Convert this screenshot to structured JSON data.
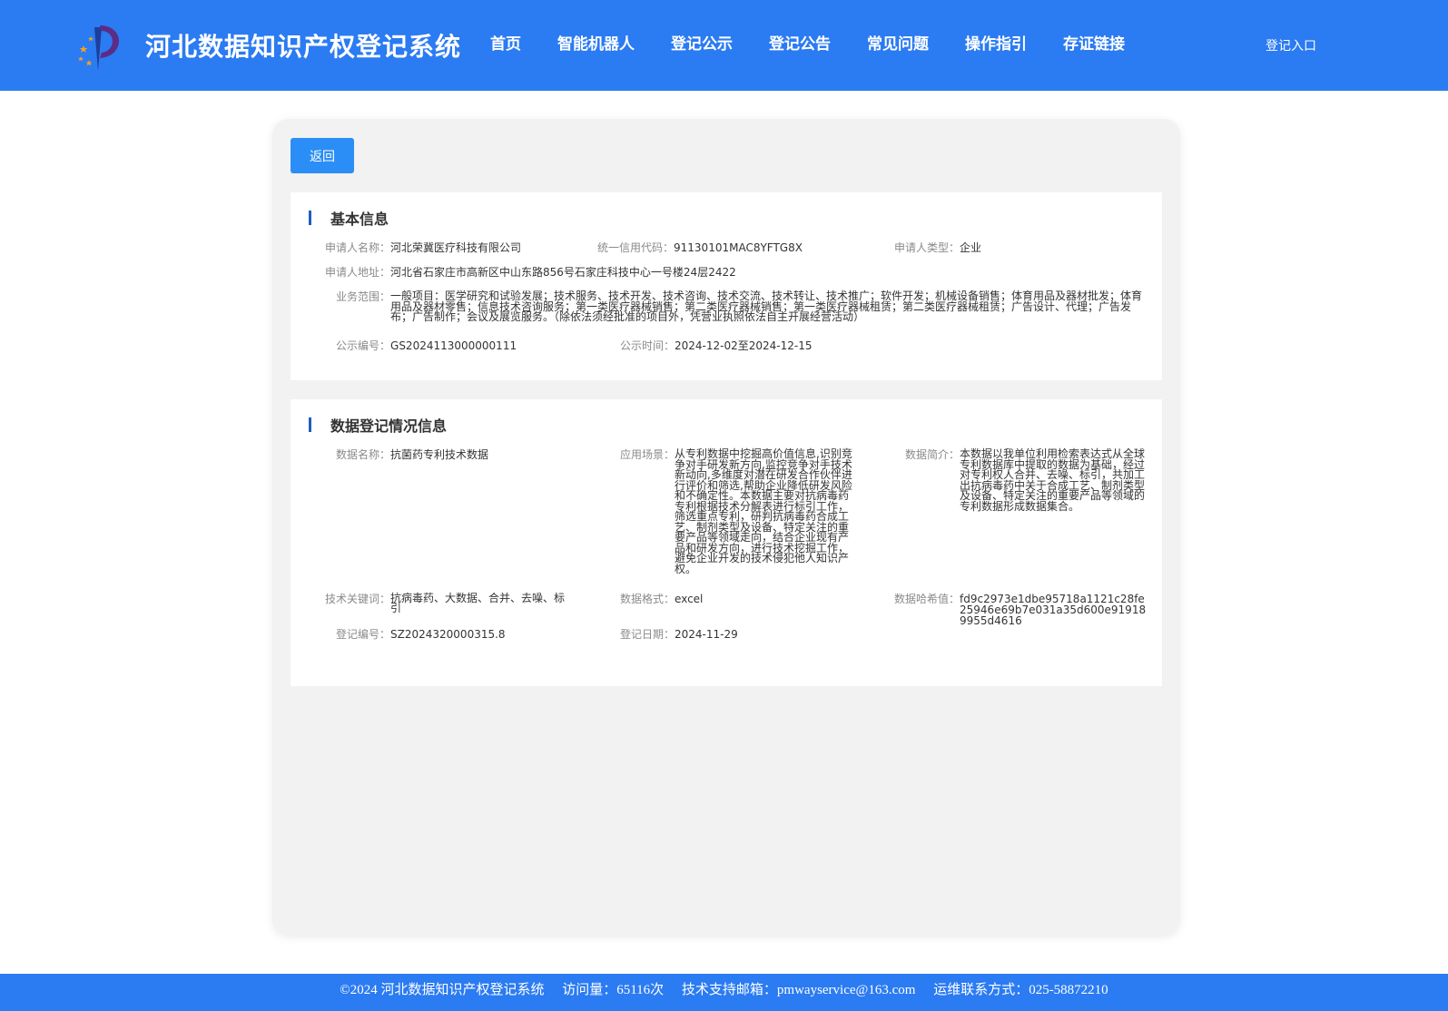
{
  "header": {
    "title": "河北数据知识产权登记系统",
    "login": "登记入口",
    "nav": [
      "首页",
      "智能机器人",
      "登记公示",
      "登记公告",
      "常见问题",
      "操作指引",
      "存证链接"
    ]
  },
  "back_label": "返回",
  "basic": {
    "heading": "基本信息",
    "applicant_name_label": "申请人名称：",
    "applicant_name": "河北荣冀医疗科技有限公司",
    "credit_code_label": "统一信用代码：",
    "credit_code": "91130101MAC8YFTG8X",
    "applicant_type_label": "申请人类型：",
    "applicant_type": "企业",
    "address_label": "申请人地址：",
    "address": "河北省石家庄市高新区中山东路856号石家庄科技中心一号楼24层2422",
    "scope_label": "业务范围：",
    "scope": "一般项目：医学研究和试验发展；技术服务、技术开发、技术咨询、技术交流、技术转让、技术推广；软件开发；机械设备销售；体育用品及器材批发；体育用品及器材零售；信息技术咨询服务；第一类医疗器械销售；第二类医疗器械销售；第一类医疗器械租赁；第二类医疗器械租赁；广告设计、代理；广告发布；广告制作；会议及展览服务。（除依法须经批准的项目外，凭营业执照依法自主开展经营活动）",
    "notice_no_label": "公示编号：",
    "notice_no": "GS2024113000000111",
    "notice_time_label": "公示时间：",
    "notice_time": "2024-12-02至2024-12-15"
  },
  "registration": {
    "heading": "数据登记情况信息",
    "data_name_label": "数据名称：",
    "data_name": "抗菌药专利技术数据",
    "scenario_label": "应用场景：",
    "scenario": "从专利数据中挖掘高价值信息,识别竞争对手研发新方向,监控竞争对手技术新动向,多维度对潜在研发合作伙伴进行评价和筛选,帮助企业降低研发风险和不确定性。本数据主要对抗病毒药专利根据技术分解表进行标引工作，筛选重点专利，研判抗病毒药合成工艺、制剂类型及设备、特定关注的重要产品等领域走向，结合企业现有产品和研发方向，进行技术挖掘工作，避免企业开发的技术侵犯他人知识产权。",
    "intro_label": "数据简介：",
    "intro": "本数据以我单位利用检索表达式从全球专利数据库中提取的数据为基础，经过对专利权人合并、去噪、标引，共加工出抗病毒药中关于合成工艺、制剂类型及设备、特定关注的重要产品等领域的专利数据形成数据集合。",
    "keywords_label": "技术关键词：",
    "keywords": "抗病毒药、大数据、合并、去噪、标引",
    "format_label": "数据格式：",
    "format": "excel",
    "hash_label": "数据哈希值：",
    "hash": "fd9c2973e1dbe95718a1121c28fe25946e69b7e031a35d600e919189955d4616",
    "reg_no_label": "登记编号：",
    "reg_no": "SZ2024320000315.8",
    "reg_date_label": "登记日期：",
    "reg_date": "2024-11-29"
  },
  "footer": {
    "copyright": "©2024 河北数据知识产权登记系统",
    "visits": "访问量：65116次",
    "email": "技术支持邮箱：pmwayservice@163.com",
    "phone": "运维联系方式：025-58872210"
  },
  "colors": {
    "header_bg": "#2b7bf2",
    "button_bg": "#2b8ef6",
    "title_bar": "#1d5fbf"
  }
}
